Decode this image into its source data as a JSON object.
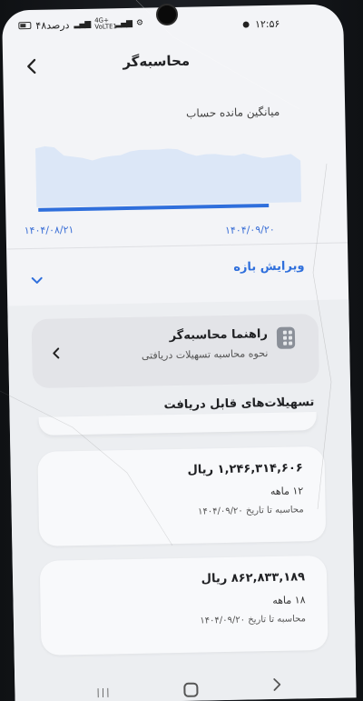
{
  "status_bar": {
    "time": "۱۲:۵۶",
    "battery_percent": "۴۸درصد",
    "network_label": "4G+ VoLTE1"
  },
  "app_bar": {
    "title": "محاسبه‌گر"
  },
  "balance_chart": {
    "title": "میانگین مانده حساب",
    "start_date": "۱۴۰۴/۰۸/۲۱",
    "end_date": "۱۴۰۴/۰۹/۲۰"
  },
  "chart_data": {
    "type": "area",
    "title": "میانگین مانده حساب",
    "x": [
      "۱۴۰۴/۰۸/۲۱",
      "۱۴۰۴/۰۹/۲۰"
    ],
    "values": [
      0.85,
      0.88,
      0.86,
      0.74,
      0.72,
      0.7,
      0.66,
      0.7,
      0.72,
      0.73,
      0.78,
      0.8,
      0.8,
      0.8,
      0.81,
      0.8,
      0.74,
      0.7,
      0.72,
      0.72,
      0.7,
      0.69,
      0.72,
      0.68,
      0.65,
      0.66,
      0.68,
      0.7,
      0.6
    ],
    "fill_color": "#dce7f7",
    "line_color": "#2f6fdc",
    "grid": false
  },
  "edit_range": {
    "label": "ویرایش بازه"
  },
  "guide_card": {
    "title": "راهنما محاسبه‌گر",
    "subtitle": "نحوه محاسبه تسهیلات دریافتی"
  },
  "loans_section": {
    "title": "تسهیلات‌های قابل دریافت"
  },
  "loans": [
    {
      "amount": "۱,۲۴۶,۳۱۴,۶۰۶ ریال",
      "term": "۱۲ ماهه",
      "date_note": "محاسبه تا تاریخ ۱۴۰۴/۰۹/۲۰"
    },
    {
      "amount": "۸۶۲,۸۳۳,۱۸۹ ریال",
      "term": "۱۸ ماهه",
      "date_note": "محاسبه تا تاریخ ۱۴۰۴/۰۹/۲۰"
    }
  ],
  "colors": {
    "accent": "#2f6fdc",
    "background": "#f3f4f7"
  }
}
